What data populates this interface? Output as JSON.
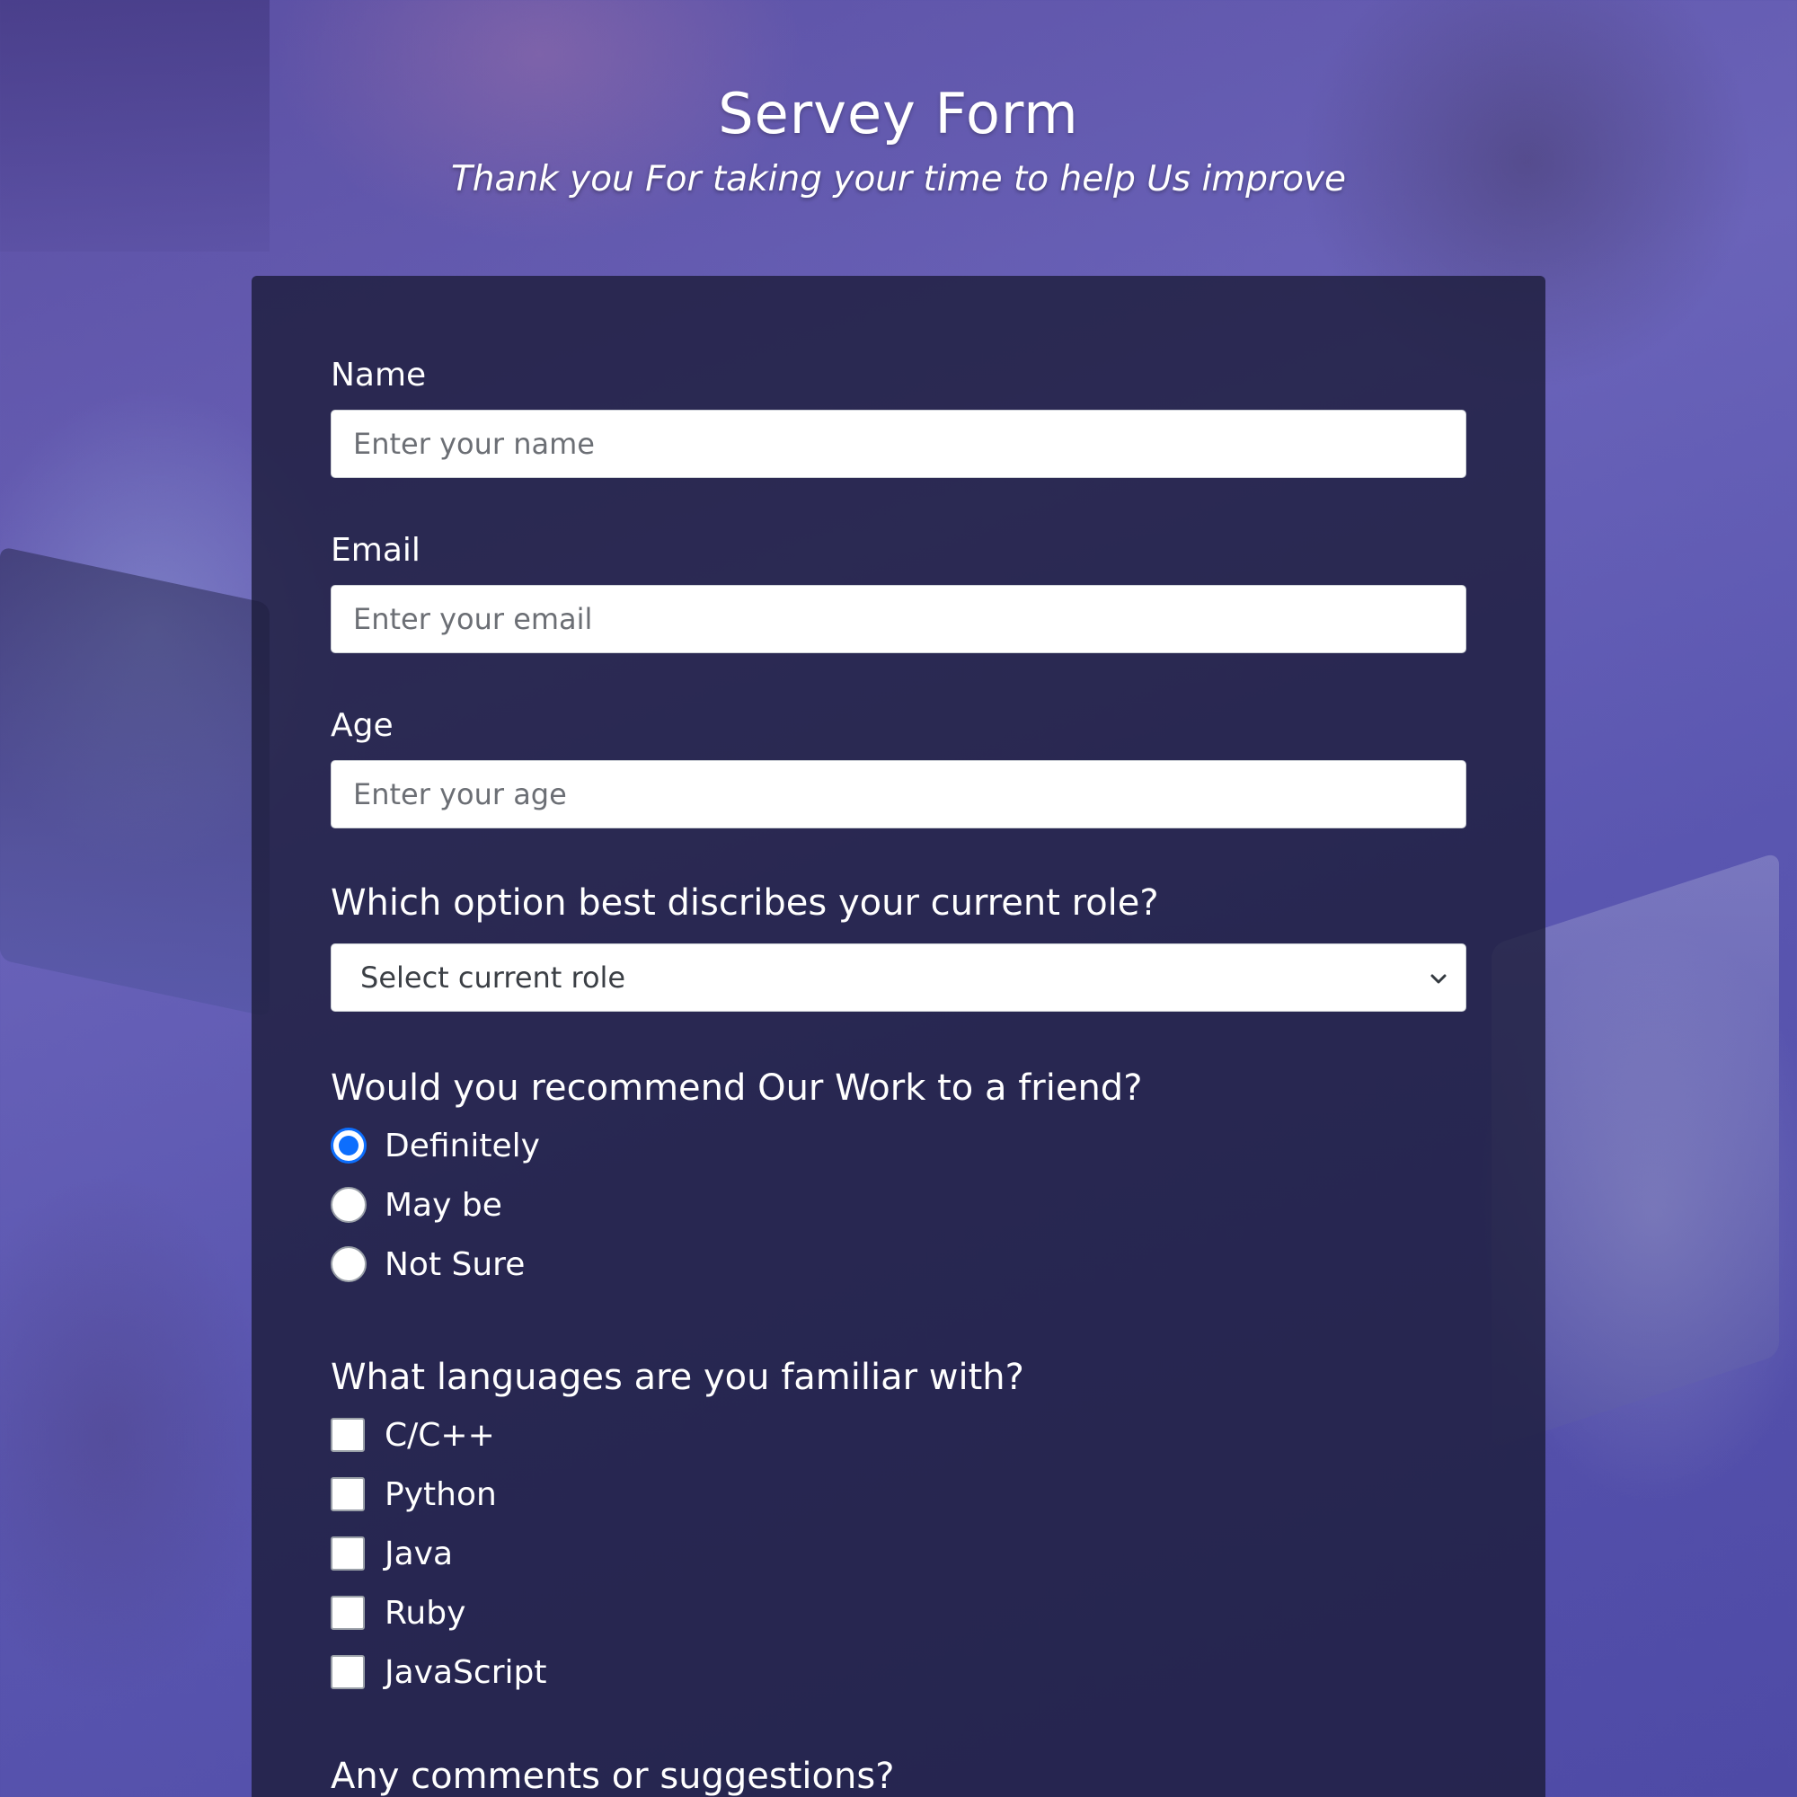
{
  "header": {
    "title": "Servey Form",
    "subtitle": "Thank you For taking your time to help Us improve"
  },
  "form": {
    "name": {
      "label": "Name",
      "placeholder": "Enter your name",
      "value": ""
    },
    "email": {
      "label": "Email",
      "placeholder": "Enter your email",
      "value": ""
    },
    "age": {
      "label": "Age",
      "placeholder": "Enter your age",
      "value": ""
    },
    "role": {
      "question": "Which option best discribes your current role?",
      "selected": "Select current role"
    },
    "recommend": {
      "question": "Would you recommend Our Work to a friend?",
      "options": [
        {
          "label": "Definitely",
          "checked": true
        },
        {
          "label": "May be",
          "checked": false
        },
        {
          "label": "Not Sure",
          "checked": false
        }
      ]
    },
    "languages": {
      "question": "What languages are you familiar with?",
      "options": [
        {
          "label": "C/C++",
          "checked": false
        },
        {
          "label": "Python",
          "checked": false
        },
        {
          "label": "Java",
          "checked": false
        },
        {
          "label": "Ruby",
          "checked": false
        },
        {
          "label": "JavaScript",
          "checked": false
        }
      ]
    },
    "comments": {
      "question": "Any comments or suggestions?"
    }
  },
  "colors": {
    "accent": "#0d6efd",
    "card": "#1b1c3a",
    "background": "#5a56b0"
  }
}
